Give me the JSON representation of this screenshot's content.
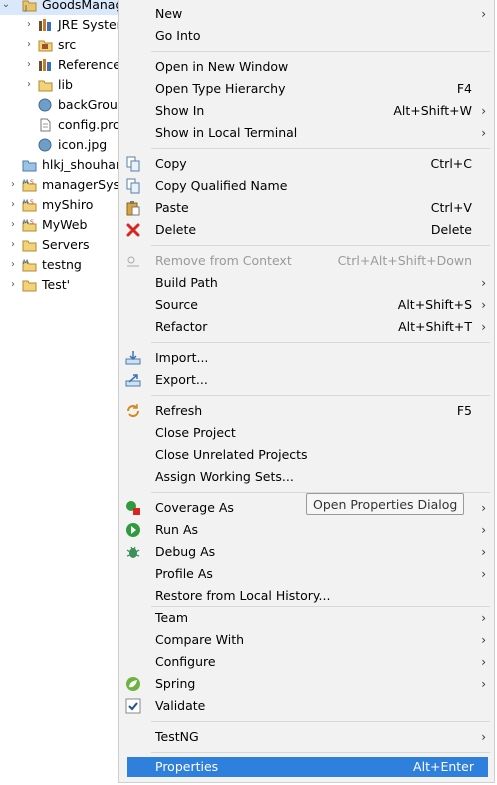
{
  "tree": {
    "items": [
      {
        "label": "GoodsManage",
        "icon": "java-project-icon",
        "expanded": true
      },
      {
        "label": "JRE System Library",
        "icon": "library-icon"
      },
      {
        "label": "src",
        "icon": "source-folder-icon"
      },
      {
        "label": "Referenced Libraries",
        "icon": "library-icon"
      },
      {
        "label": "lib",
        "icon": "folder-icon"
      },
      {
        "label": "backGround",
        "icon": "image-file-icon"
      },
      {
        "label": "config.properties",
        "icon": "file-icon"
      },
      {
        "label": "icon.jpg",
        "icon": "image-file-icon"
      },
      {
        "label": "hlkj_shouhan",
        "icon": "folder-icon"
      },
      {
        "label": "managerSystem",
        "icon": "maven-project-icon"
      },
      {
        "label": "myShiro",
        "icon": "maven-project-icon"
      },
      {
        "label": "MyWeb",
        "icon": "maven-project-icon"
      },
      {
        "label": "Servers",
        "icon": "folder-icon"
      },
      {
        "label": "testng",
        "icon": "project-icon"
      },
      {
        "label": "Test'",
        "icon": "folder-icon"
      }
    ]
  },
  "menu": {
    "items": [
      {
        "label": "New",
        "submenu": true
      },
      {
        "label": "Go Into"
      },
      {
        "label": "Open in New Window"
      },
      {
        "label": "Open Type Hierarchy",
        "accel": "F4"
      },
      {
        "label": "Show In",
        "accel": "Alt+Shift+W",
        "submenu": true
      },
      {
        "label": "Show in Local Terminal",
        "submenu": true
      },
      {
        "label": "Copy",
        "accel": "Ctrl+C",
        "icon": "copy-icon"
      },
      {
        "label": "Copy Qualified Name",
        "icon": "copy-qualified-name-icon"
      },
      {
        "label": "Paste",
        "accel": "Ctrl+V",
        "icon": "paste-icon"
      },
      {
        "label": "Delete",
        "accel": "Delete",
        "icon": "delete-icon"
      },
      {
        "label": "Remove from Context",
        "accel": "Ctrl+Alt+Shift+Down",
        "disabled": true,
        "icon": "remove-context-icon"
      },
      {
        "label": "Build Path",
        "submenu": true
      },
      {
        "label": "Source",
        "accel": "Alt+Shift+S",
        "submenu": true
      },
      {
        "label": "Refactor",
        "accel": "Alt+Shift+T",
        "submenu": true
      },
      {
        "label": "Import...",
        "icon": "import-icon"
      },
      {
        "label": "Export...",
        "icon": "export-icon"
      },
      {
        "label": "Refresh",
        "accel": "F5",
        "icon": "refresh-icon"
      },
      {
        "label": "Close Project"
      },
      {
        "label": "Close Unrelated Projects"
      },
      {
        "label": "Assign Working Sets..."
      },
      {
        "label": "Coverage As",
        "submenu": true,
        "icon": "coverage-icon"
      },
      {
        "label": "Run As",
        "submenu": true,
        "icon": "run-icon"
      },
      {
        "label": "Debug As",
        "submenu": true,
        "icon": "debug-icon"
      },
      {
        "label": "Profile As",
        "submenu": true
      },
      {
        "label": "Restore from Local History..."
      },
      {
        "label": "Team",
        "submenu": true
      },
      {
        "label": "Compare With",
        "submenu": true
      },
      {
        "label": "Configure",
        "submenu": true
      },
      {
        "label": "Spring",
        "submenu": true,
        "icon": "spring-icon"
      },
      {
        "label": "Validate",
        "icon": "validate-checkbox-icon"
      },
      {
        "label": "TestNG",
        "submenu": true
      },
      {
        "label": "Properties",
        "accel": "Alt+Enter",
        "highlighted": true
      }
    ],
    "tooltip": "Open Properties Dialog"
  },
  "colors": {
    "highlight": "#2f7fdd",
    "menu_bg": "#f2f2f2",
    "disabled_text": "#9a9a9a",
    "tree_selection": "#d9e8fb"
  }
}
